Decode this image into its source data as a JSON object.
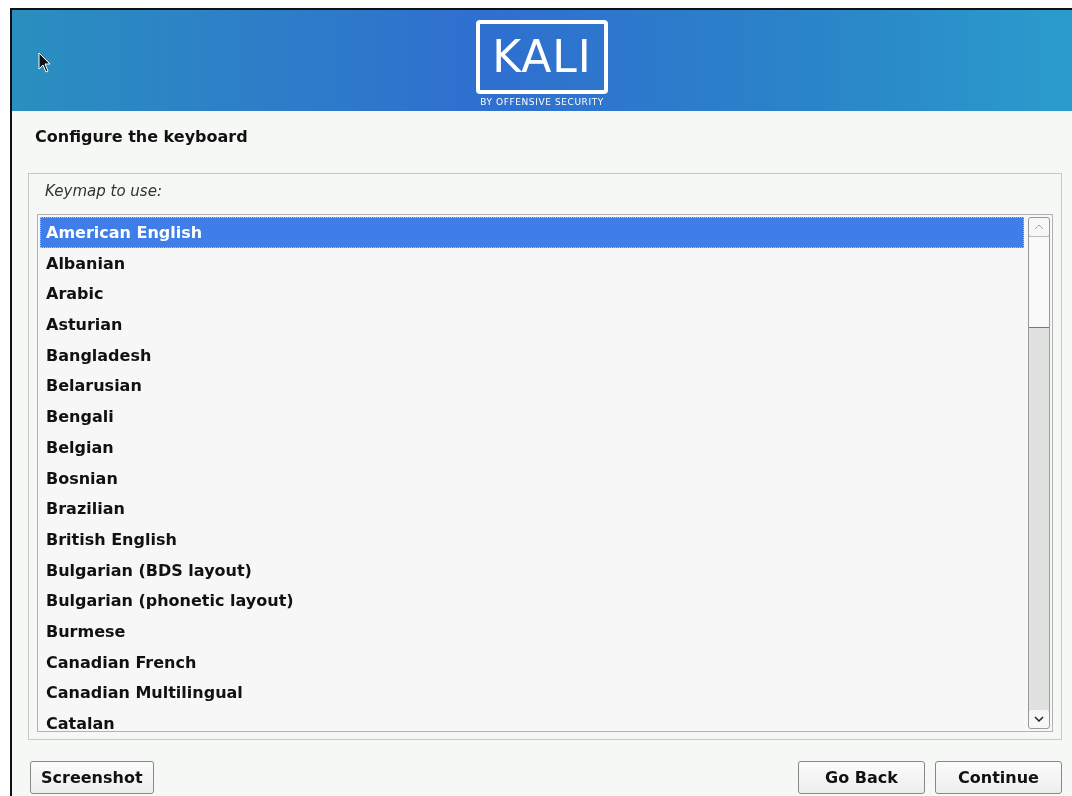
{
  "logo": {
    "wordmark": "KALI",
    "tagline": "BY OFFENSIVE SECURITY"
  },
  "title": "Configure the keyboard",
  "prompt": "Keymap to use:",
  "keymaps": [
    {
      "label": "American English",
      "selected": true
    },
    {
      "label": "Albanian",
      "selected": false
    },
    {
      "label": "Arabic",
      "selected": false
    },
    {
      "label": "Asturian",
      "selected": false
    },
    {
      "label": "Bangladesh",
      "selected": false
    },
    {
      "label": "Belarusian",
      "selected": false
    },
    {
      "label": "Bengali",
      "selected": false
    },
    {
      "label": "Belgian",
      "selected": false
    },
    {
      "label": "Bosnian",
      "selected": false
    },
    {
      "label": "Brazilian",
      "selected": false
    },
    {
      "label": "British English",
      "selected": false
    },
    {
      "label": "Bulgarian (BDS layout)",
      "selected": false
    },
    {
      "label": "Bulgarian (phonetic layout)",
      "selected": false
    },
    {
      "label": "Burmese",
      "selected": false
    },
    {
      "label": "Canadian French",
      "selected": false
    },
    {
      "label": "Canadian Multilingual",
      "selected": false
    },
    {
      "label": "Catalan",
      "selected": false
    }
  ],
  "buttons": {
    "left": [
      "Screenshot"
    ],
    "right": [
      "Go Back",
      "Continue"
    ]
  }
}
